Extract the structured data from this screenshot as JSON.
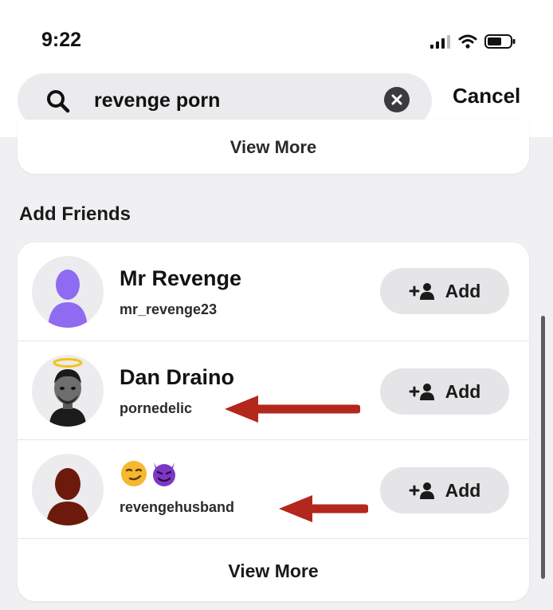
{
  "status_bar": {
    "time": "9:22",
    "signal_icon": "signal-icon",
    "wifi_icon": "wifi-icon",
    "battery_icon": "battery-icon"
  },
  "search": {
    "value": "revenge porn",
    "icon": "search-icon",
    "clear_icon": "clear-icon",
    "cancel_label": "Cancel"
  },
  "top_section": {
    "view_more_label": "View More"
  },
  "add_friends": {
    "title": "Add Friends",
    "add_label": "Add",
    "friends": [
      {
        "display_name": "Mr Revenge",
        "username": "mr_revenge23",
        "avatar": "purple-silhouette-avatar"
      },
      {
        "display_name": "Dan Draino",
        "username": "pornedelic",
        "avatar": "bitmoji-halo-avatar"
      },
      {
        "display_name": "😏😈",
        "username": "revengehusband",
        "avatar": "dark-red-silhouette-avatar"
      }
    ],
    "view_more_label": "View More"
  },
  "annotations": {
    "arrow_color": "#b3271c"
  },
  "colors": {
    "accent_purple": "#8e6bf0",
    "dark_red": "#6b1a0c",
    "add_button_bg": "#e5e5e8"
  }
}
